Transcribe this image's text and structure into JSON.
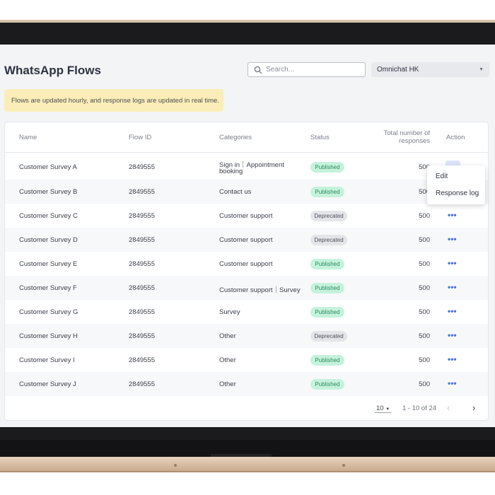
{
  "header": {
    "title": "WhatsApp Flows",
    "search_placeholder": "Search...",
    "account_select": "Omnichat HK"
  },
  "banner": "Flows are updated hourly, and response logs are updated in real time.",
  "table": {
    "columns": {
      "name": "Name",
      "flow_id": "Flow ID",
      "categories": "Categories",
      "status": "Status",
      "total_line1": "Total number of",
      "total_line2": "responses",
      "action": "Action"
    },
    "rows": [
      {
        "name": "Customer Survey A",
        "flow_id": "2849555",
        "cat1": "Sign in｜Appointment",
        "cat2": "booking",
        "status": "Published",
        "total": "500"
      },
      {
        "name": "Customer Survey B",
        "flow_id": "2849555",
        "cat1": "Contact us",
        "cat2": "",
        "status": "Published",
        "total": "500"
      },
      {
        "name": "Customer Survey C",
        "flow_id": "2849555",
        "cat1": "Customer support",
        "cat2": "",
        "status": "Deprecated",
        "total": "500"
      },
      {
        "name": "Customer Survey D",
        "flow_id": "2849555",
        "cat1": "Customer support",
        "cat2": "",
        "status": "Deprecated",
        "total": "500"
      },
      {
        "name": "Customer Survey E",
        "flow_id": "2849555",
        "cat1": "Customer support",
        "cat2": "",
        "status": "Published",
        "total": "500"
      },
      {
        "name": "Customer Survey F",
        "flow_id": "2849555",
        "cat1": "Customer support｜Survey",
        "cat2": "",
        "status": "Published",
        "total": "500"
      },
      {
        "name": "Customer Survey G",
        "flow_id": "2849555",
        "cat1": "Survey",
        "cat2": "",
        "status": "Published",
        "total": "500"
      },
      {
        "name": "Customer Survey H",
        "flow_id": "2849555",
        "cat1": "Other",
        "cat2": "",
        "status": "Deprecated",
        "total": "500"
      },
      {
        "name": "Customer Survey I",
        "flow_id": "2849555",
        "cat1": "Other",
        "cat2": "",
        "status": "Published",
        "total": "500"
      },
      {
        "name": "Customer Survey J",
        "flow_id": "2849555",
        "cat1": "Other",
        "cat2": "",
        "status": "Published",
        "total": "500"
      }
    ],
    "action_glyph": "•••"
  },
  "menu": {
    "edit": "Edit",
    "response_log": "Response log"
  },
  "pagination": {
    "page_size": "10",
    "range": "1 - 10 of  24",
    "prev": "‹",
    "next": "›"
  },
  "colors": {
    "published_bg": "#c5f2dc",
    "deprecated_bg": "#e4e5e8",
    "banner_bg": "#fbedb7",
    "accent": "#4a73e8"
  }
}
